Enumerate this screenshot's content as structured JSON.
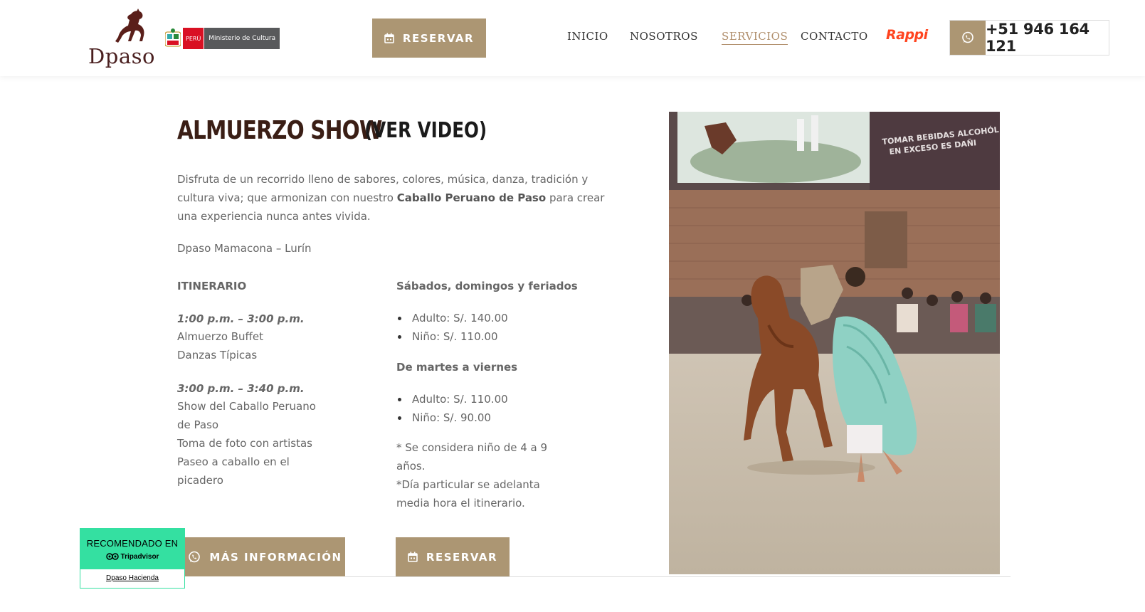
{
  "header": {
    "logo_text": "Dpaso",
    "peru_label": "PERÚ",
    "ministry_label": "Ministerio de Cultura",
    "reservar_label": "RESERVAR",
    "nav": [
      {
        "label": "INICIO",
        "active": false
      },
      {
        "label": "NOSOTROS",
        "active": false
      },
      {
        "label": "SERVICIOS",
        "active": true
      },
      {
        "label": "CONTACTO",
        "active": false
      }
    ],
    "rappi_label": "Rappi",
    "phone": "+51 946 164 121"
  },
  "main": {
    "title": "ALMUERZO SHOW",
    "video_link": "(VER VIDEO)",
    "intro_before": "Disfruta de un recorrido lleno de sabores, colores, música, danza, tradición y cultura viva; que armonizan con nuestro ",
    "intro_bold": "Caballo Peruano de Paso",
    "intro_after": " para crear una experiencia nunca antes vivida.",
    "location": "Dpaso Mamacona – Lurín",
    "itinerary_heading": "ITINERARIO",
    "slot1_time": "1:00 p.m. – 3:00 p.m.",
    "slot1_items": [
      "Almuerzo Buffet",
      "Danzas Típicas"
    ],
    "slot2_time": "3:00 p.m. – 3:40 p.m.",
    "slot2_items": [
      "Show del Caballo Peruano",
      "de Paso",
      "Toma de foto con artistas",
      "Paseo a caballo en el",
      "picadero"
    ],
    "weekend_heading": "Sábados, domingos y feriados",
    "weekend_prices": [
      "Adulto: S/. 140.00",
      "Niño: S/. 110.00"
    ],
    "weekday_heading": "De martes a viernes",
    "weekday_prices": [
      "Adulto: S/. 110.00",
      "Niño: S/. 90.00"
    ],
    "note_lines": [
      "* Se considera niño de 4 a 9",
      "años.",
      "*Día particular se adelanta",
      "media hora el itinerario."
    ],
    "mas_info_label": "MÁS INFORMACIÓN",
    "reservar_label": "RESERVAR",
    "photo_sign": [
      "TOMAR BEBIDAS ALCOHÓL",
      "EN EXCESO ES DAÑI"
    ]
  },
  "tripadvisor": {
    "recommended": "RECOMENDADO EN",
    "brand": "Tripadvisor",
    "link": "Dpaso Hacienda"
  },
  "colors": {
    "accent": "#ac9673",
    "title": "#3a1e15",
    "active_nav": "#b08e6b",
    "rappi": "#ff441f",
    "tripadvisor": "#34e0a1"
  }
}
